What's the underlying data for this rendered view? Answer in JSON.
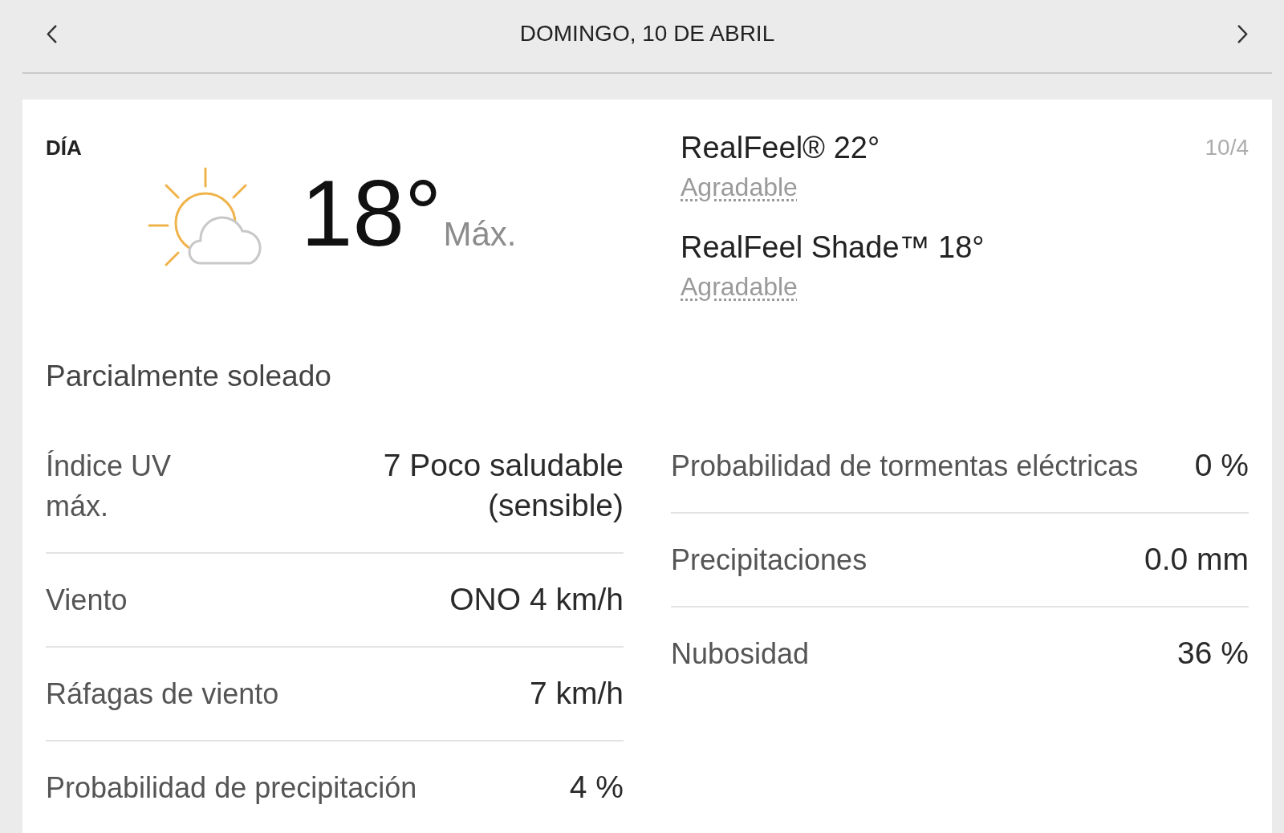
{
  "header": {
    "title": "DOMINGO, 10 DE ABRIL"
  },
  "day_panel": {
    "period": "DÍA",
    "temperature": "18°",
    "temperature_label": "Máx.",
    "date": "10/4",
    "real_feel": [
      {
        "label": "RealFeel® 22°",
        "phrase": "Agradable"
      },
      {
        "label": "RealFeel Shade™ 18°",
        "phrase": "Agradable"
      }
    ],
    "condition": "Parcialmente soleado",
    "details_left": [
      {
        "label": "Índice UV máx.",
        "value": "7 Poco saludable (sensible)"
      },
      {
        "label": "Viento",
        "value": "ONO 4 km/h"
      },
      {
        "label": "Ráfagas de viento",
        "value": "7 km/h"
      },
      {
        "label": "Probabilidad de precipitación",
        "value": "4 %"
      }
    ],
    "details_right": [
      {
        "label": "Probabilidad de tormentas eléctricas",
        "value": "0 %"
      },
      {
        "label": "Precipitaciones",
        "value": "0.0 mm"
      },
      {
        "label": "Nubosidad",
        "value": "36 %"
      }
    ]
  }
}
